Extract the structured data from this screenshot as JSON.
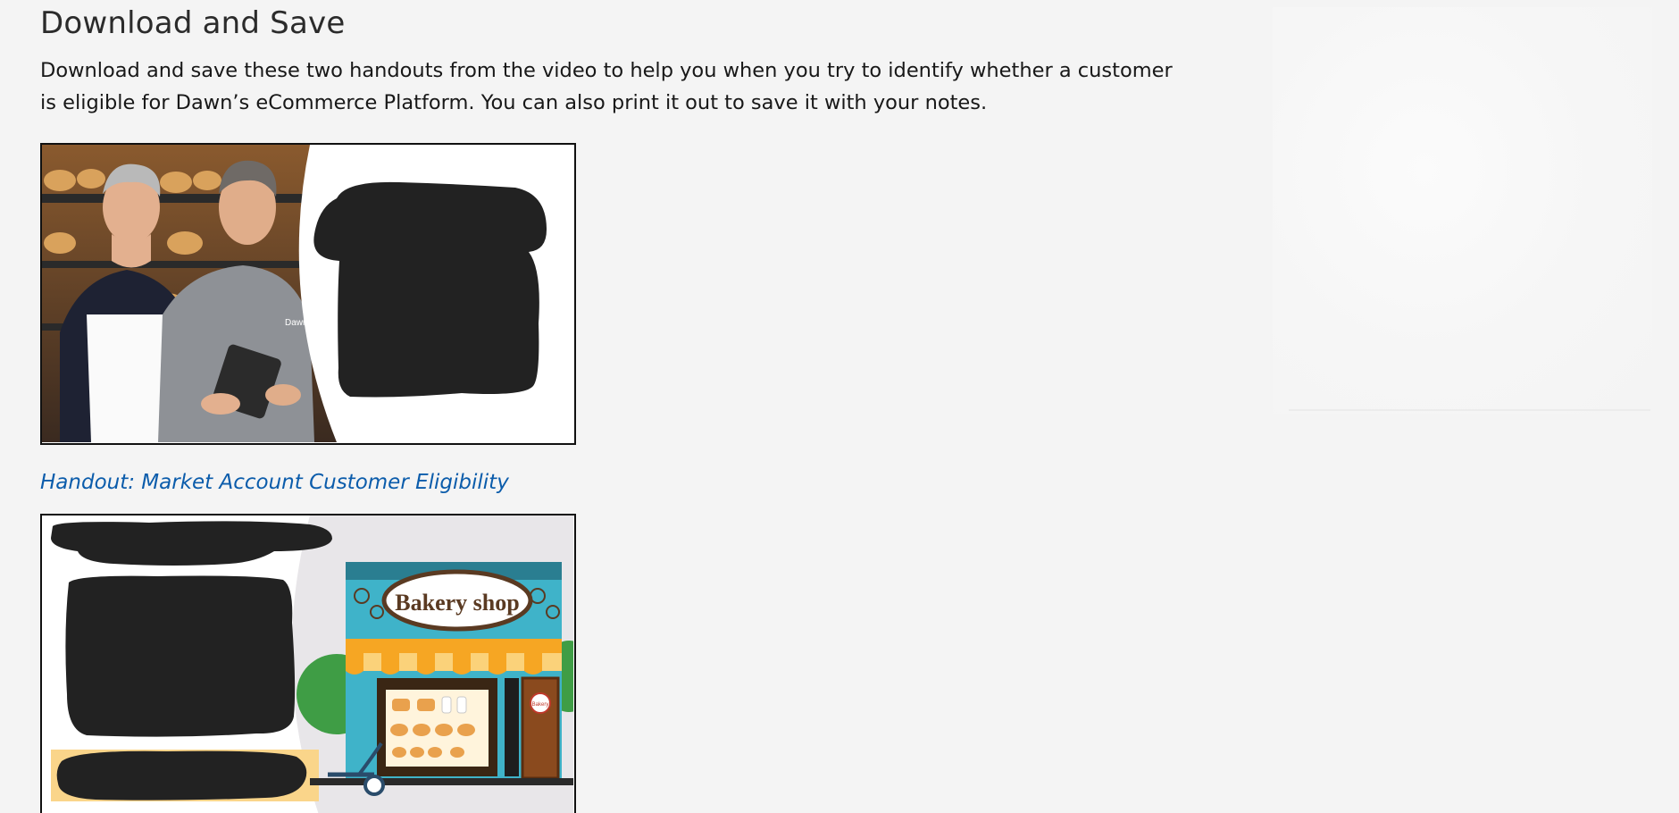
{
  "section": {
    "heading": "Download and Save",
    "intro": "Download and save these two handouts from the video to help you when you try to identify whether a customer is eligible for Dawn’s eCommerce Platform.  You can also print it out to save it with your notes."
  },
  "handouts": [
    {
      "image": {
        "shirt_logo_text": "Dawn"
      },
      "link_label": "Handout: Market Account Customer Eligibility"
    },
    {
      "image": {
        "shop_sign_text": "Bakery shop",
        "door_sign_text": "Bakery"
      }
    }
  ],
  "colors": {
    "page_bg": "#f4f4f4",
    "link": "#0b5cab",
    "redaction": "#222222",
    "awning_orange": "#f6a623",
    "shop_teal": "#3fb3c9"
  }
}
